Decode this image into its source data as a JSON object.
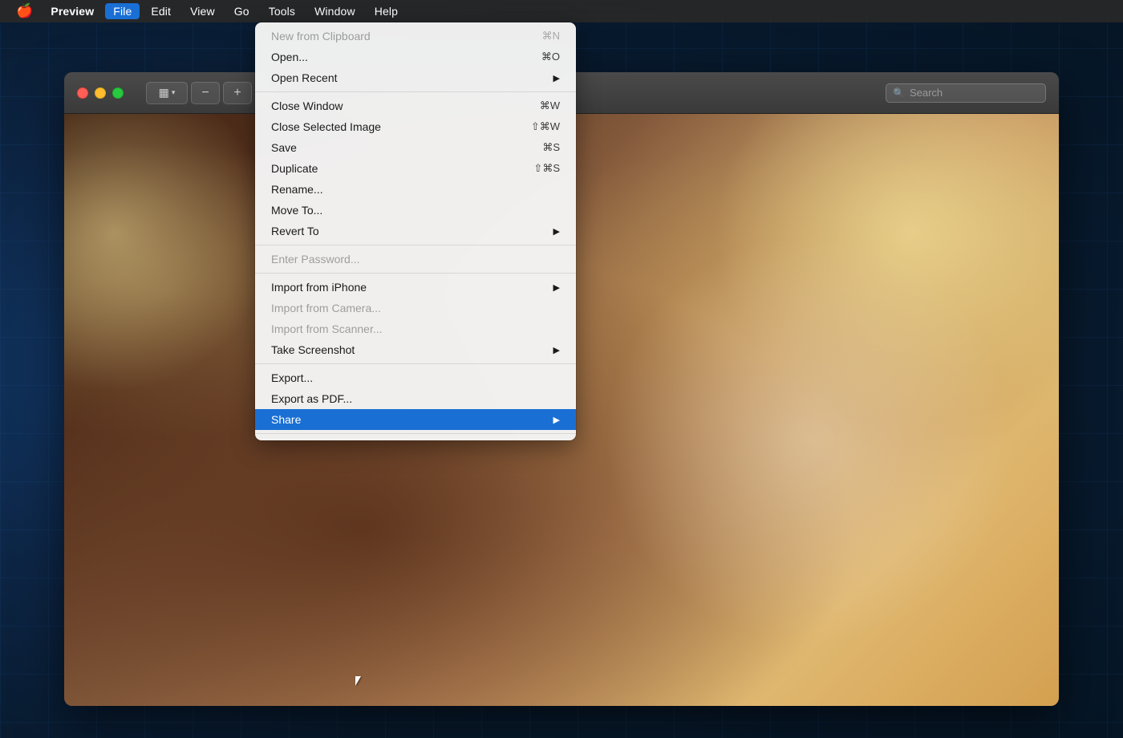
{
  "menubar": {
    "apple_icon": "🍎",
    "items": [
      {
        "label": "Preview",
        "id": "preview",
        "bold": true
      },
      {
        "label": "File",
        "id": "file",
        "active": true
      },
      {
        "label": "Edit",
        "id": "edit"
      },
      {
        "label": "View",
        "id": "view"
      },
      {
        "label": "Go",
        "id": "go"
      },
      {
        "label": "Tools",
        "id": "tools"
      },
      {
        "label": "Window",
        "id": "window"
      },
      {
        "label": "Help",
        "id": "help"
      }
    ]
  },
  "toolbar": {
    "sidebar_icon": "▦",
    "zoom_out_icon": "−",
    "zoom_in_icon": "+",
    "search_placeholder": "Search"
  },
  "file_menu": {
    "items": [
      {
        "id": "new-from-clipboard",
        "label": "New from Clipboard",
        "shortcut": "⌘N",
        "disabled": true,
        "submenu": false
      },
      {
        "id": "open",
        "label": "Open...",
        "shortcut": "⌘O",
        "disabled": false,
        "submenu": false
      },
      {
        "id": "open-recent",
        "label": "Open Recent",
        "shortcut": "",
        "disabled": false,
        "submenu": true
      },
      {
        "id": "separator1",
        "type": "separator"
      },
      {
        "id": "close-window",
        "label": "Close Window",
        "shortcut": "⌘W",
        "disabled": false,
        "submenu": false
      },
      {
        "id": "close-selected-image",
        "label": "Close Selected Image",
        "shortcut": "⇧⌘W",
        "disabled": false,
        "submenu": false
      },
      {
        "id": "save",
        "label": "Save",
        "shortcut": "⌘S",
        "disabled": false,
        "submenu": false
      },
      {
        "id": "duplicate",
        "label": "Duplicate",
        "shortcut": "⇧⌘S",
        "disabled": false,
        "submenu": false
      },
      {
        "id": "rename",
        "label": "Rename...",
        "shortcut": "",
        "disabled": false,
        "submenu": false
      },
      {
        "id": "move-to",
        "label": "Move To...",
        "shortcut": "",
        "disabled": false,
        "submenu": false
      },
      {
        "id": "revert-to",
        "label": "Revert To",
        "shortcut": "",
        "disabled": false,
        "submenu": true
      },
      {
        "id": "separator2",
        "type": "separator"
      },
      {
        "id": "enter-password",
        "label": "Enter Password...",
        "shortcut": "",
        "disabled": true,
        "submenu": false
      },
      {
        "id": "separator3",
        "type": "separator"
      },
      {
        "id": "import-from-iphone",
        "label": "Import from iPhone",
        "shortcut": "",
        "disabled": false,
        "submenu": true
      },
      {
        "id": "import-from-camera",
        "label": "Import from Camera...",
        "shortcut": "",
        "disabled": true,
        "submenu": false
      },
      {
        "id": "import-from-scanner",
        "label": "Import from Scanner...",
        "shortcut": "",
        "disabled": true,
        "submenu": false
      },
      {
        "id": "take-screenshot",
        "label": "Take Screenshot",
        "shortcut": "",
        "disabled": false,
        "submenu": true
      },
      {
        "id": "separator4",
        "type": "separator"
      },
      {
        "id": "export",
        "label": "Export...",
        "shortcut": "",
        "disabled": false,
        "submenu": false
      },
      {
        "id": "export-as-pdf",
        "label": "Export as PDF...",
        "shortcut": "",
        "disabled": false,
        "submenu": false
      },
      {
        "id": "share",
        "label": "Share",
        "shortcut": "",
        "disabled": false,
        "submenu": true,
        "highlighted": true
      },
      {
        "id": "separator5",
        "type": "separator"
      }
    ]
  },
  "colors": {
    "menu_highlight": "#1a6fd4",
    "menu_bg": "rgba(245,245,245,0.97)",
    "menubar_bg": "rgba(40,40,40,0.92)",
    "disabled_text": "rgba(0,0,0,0.35)"
  }
}
